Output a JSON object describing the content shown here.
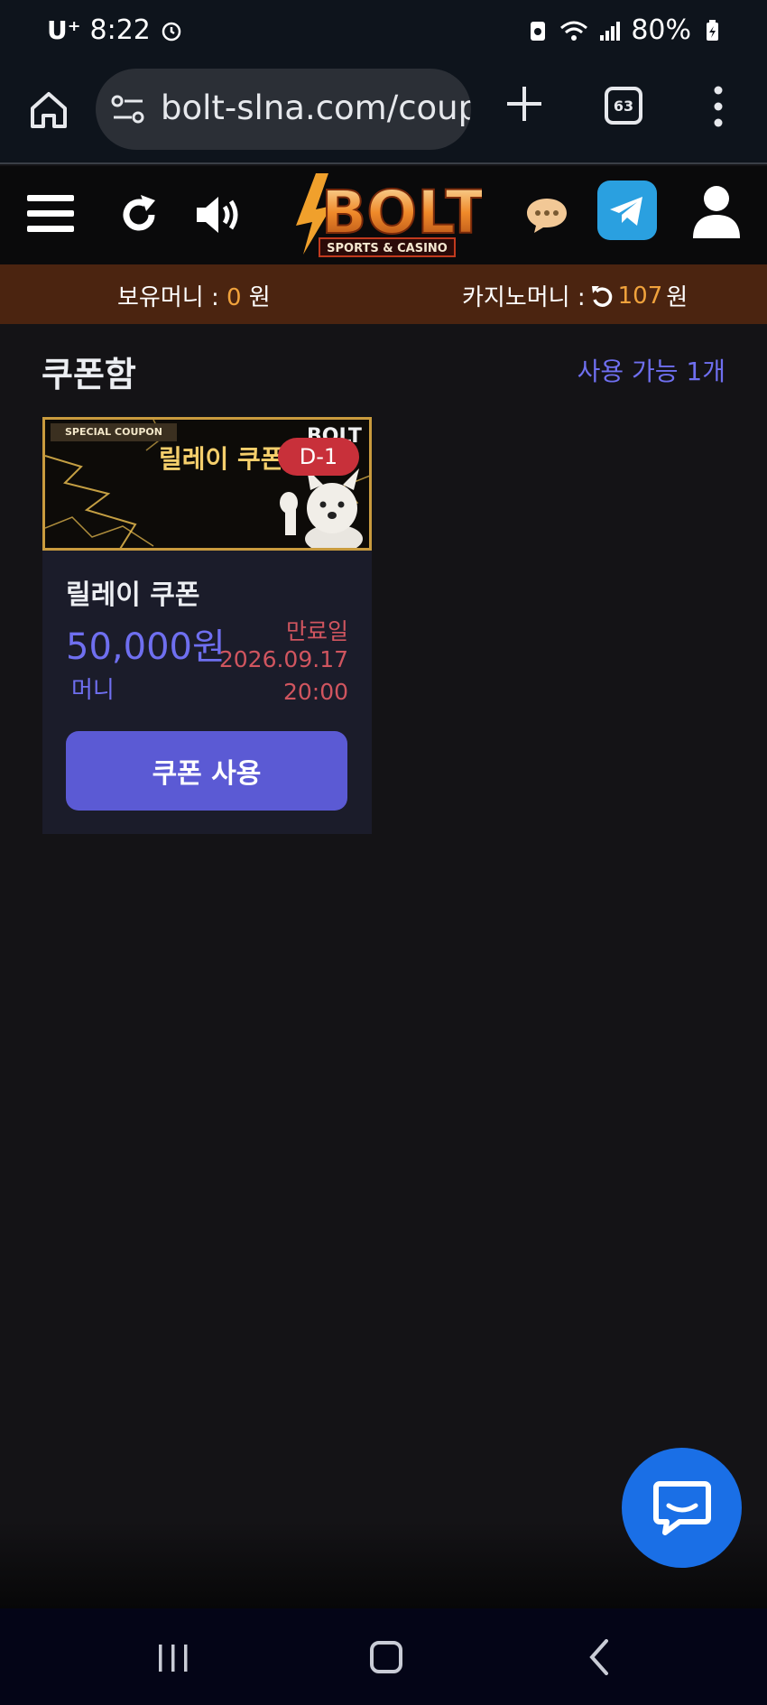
{
  "status_bar": {
    "carrier": "U⁺",
    "time": "8:22",
    "battery": "80%"
  },
  "browser": {
    "url": "bolt-slna.com/coup",
    "tab_count": "63"
  },
  "header": {
    "logo_text": "BOLT",
    "logo_subtitle": "SPORTS & CASINO"
  },
  "balance": {
    "money_label": "보유머니 :",
    "money_value": "0",
    "money_unit": "원",
    "casino_label": "카지노머니 :",
    "casino_value": "107",
    "casino_unit": "원"
  },
  "page": {
    "title": "쿠폰함",
    "available": "사용 가능 1개"
  },
  "coupon": {
    "banner_tag": "SPECIAL COUPON",
    "banner_title": "릴레이 쿠폰",
    "banner_brand": "BOLT",
    "dday": "D-1",
    "name": "릴레이 쿠폰",
    "amount": "50,000원",
    "unit": "머니",
    "expire_label": "만료일",
    "expire_date": "2026.09.17",
    "expire_time": "20:00",
    "button_label": "쿠폰 사용"
  },
  "colors": {
    "accent": "#5b5ad4",
    "balance_bar": "#4b2410",
    "amount_orange": "#f0a23c",
    "expire_red": "#d0555f",
    "chat_fab": "#1a6fe6"
  }
}
